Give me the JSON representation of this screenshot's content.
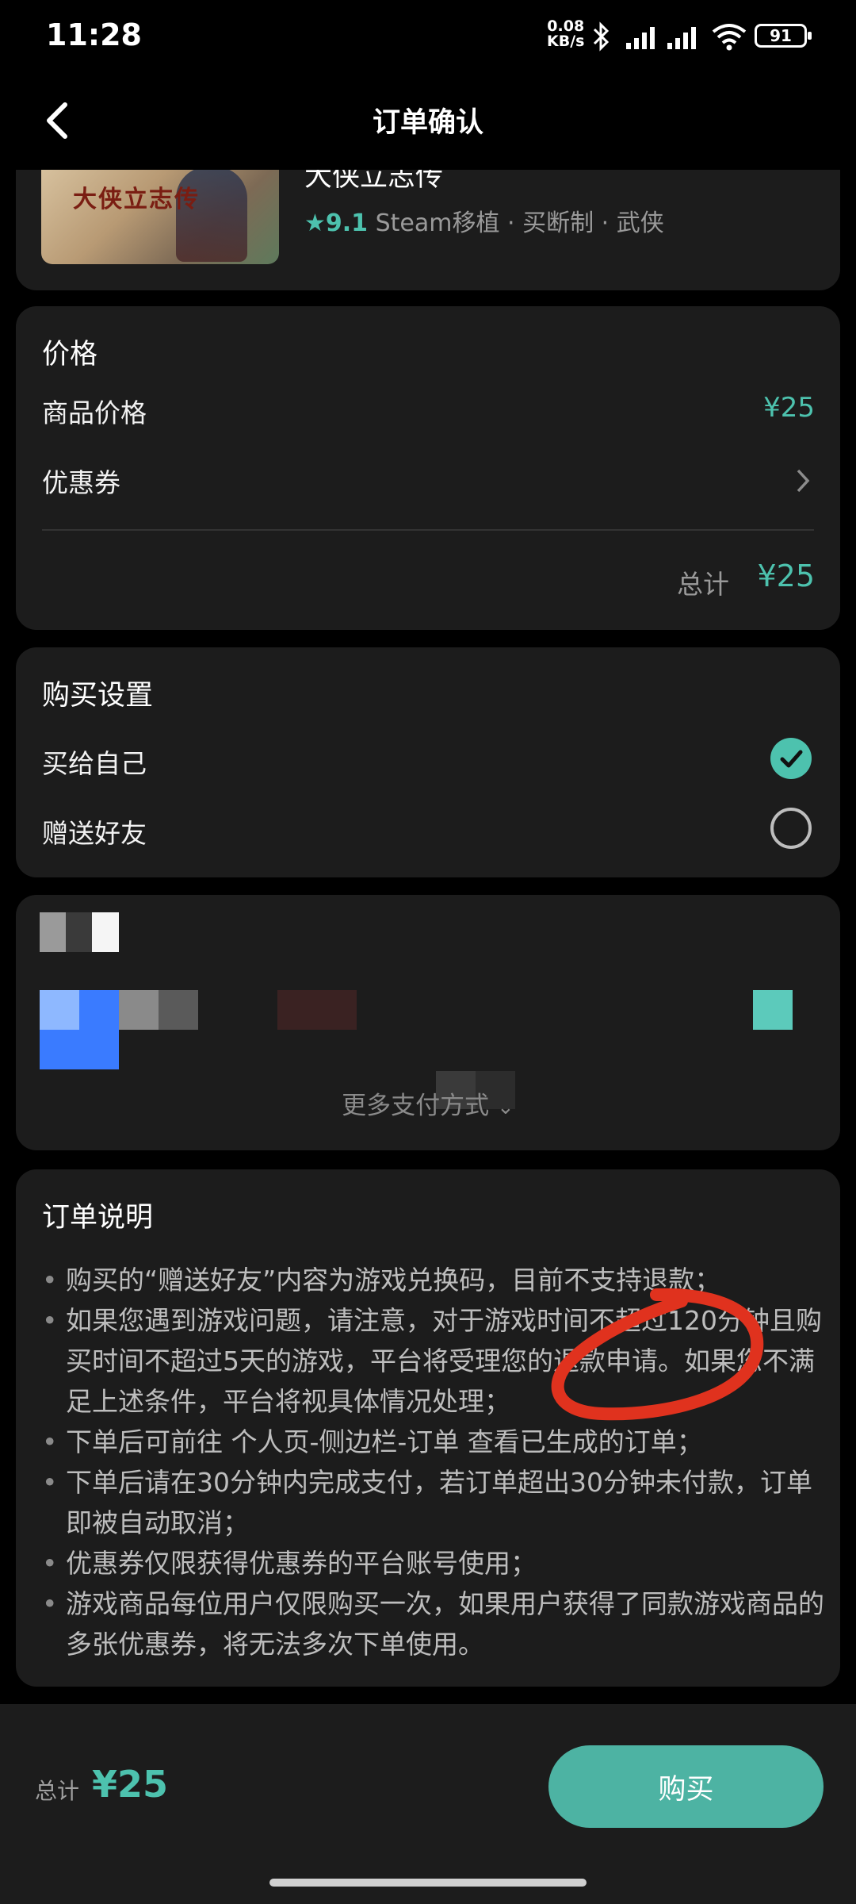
{
  "status_bar": {
    "time": "11:28",
    "speed_value": "0.08",
    "speed_unit": "KB/s",
    "battery": "91"
  },
  "header": {
    "title": "订单确认"
  },
  "game": {
    "name": "大侠立志传",
    "rating": "9.1",
    "meta": "Steam移植 · 买断制 · 武侠",
    "cover_text": "大侠立志传"
  },
  "price": {
    "section_title": "价格",
    "product_price_label": "商品价格",
    "product_price": "¥25",
    "coupon_label": "优惠券",
    "total_label": "总计",
    "total_value": "¥25"
  },
  "purchase": {
    "section_title": "购买设置",
    "options": [
      {
        "label": "买给自己",
        "selected": true
      },
      {
        "label": "赠送好友",
        "selected": false
      }
    ]
  },
  "payment": {
    "more_methods": "更多支付方式"
  },
  "notes": {
    "title": "订单说明",
    "items": [
      "购买的“赠送好友”内容为游戏兑换码，目前不支持退款；",
      "如果您遇到游戏问题，请注意，对于游戏时间不超过120分钟且购买时间不超过5天的游戏，平台将受理您的退款申请。如果您不满足上述条件，平台将视具体情况处理；",
      "下单后可前往 个人页-侧边栏-订单 查看已生成的订单；",
      "下单后请在30分钟内完成支付，若订单超出30分钟未付款，订单即被自动取消；",
      "优惠券仅限获得优惠券的平台账号使用；",
      "游戏商品每位用户仅限购买一次，如果用户获得了同款游戏商品的多张优惠券，将无法多次下单使用。"
    ]
  },
  "bottom_bar": {
    "total_label": "总计",
    "total_value": "¥25",
    "buy_label": "购买"
  },
  "colors": {
    "accent": "#4dc2ae",
    "card": "#1c1c1c",
    "annotation": "#e0321e"
  }
}
